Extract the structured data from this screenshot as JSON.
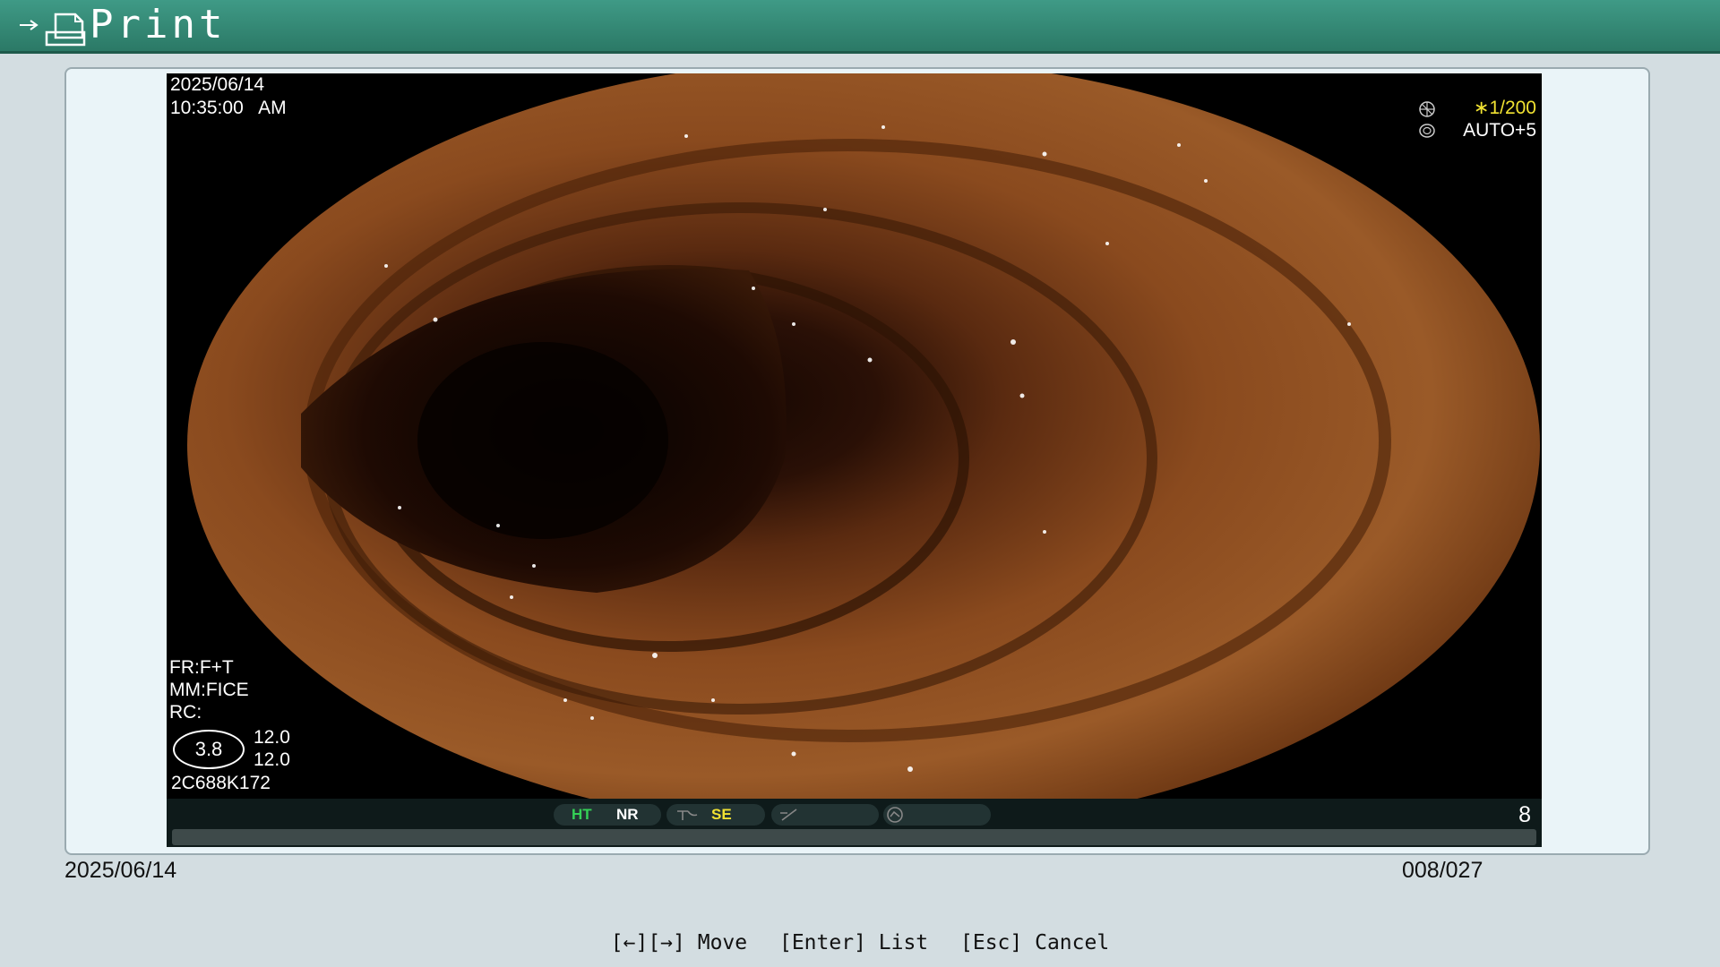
{
  "header": {
    "title": "Print",
    "arrow_icon": "arrow-right-icon",
    "doc_icon": "document-icon",
    "color": "#2b7966"
  },
  "image_osd": {
    "date": "2025/06/14",
    "time": "10:35:00   AM",
    "shutter": "∗1/200",
    "shutter_icon": "shutter-icon",
    "auto": "AUTO+5",
    "auto_icon": "iris-icon",
    "fr": "FR:F+T",
    "mm": "MM:FICE",
    "rc": "RC:",
    "ring_value": "3.8",
    "val1": "12.0",
    "val2": "12.0",
    "serial": "2C688K172"
  },
  "status_bar": {
    "ht": "HT",
    "nr": "NR",
    "se": "SE",
    "frame_number": "8",
    "ht_color": "#34d156",
    "se_color": "#f1e232"
  },
  "footer": {
    "date": "2025/06/14",
    "count": "008/027"
  },
  "hints": {
    "move": "[←][→] Move",
    "list": "[Enter] List",
    "cancel": "[Esc] Cancel"
  }
}
